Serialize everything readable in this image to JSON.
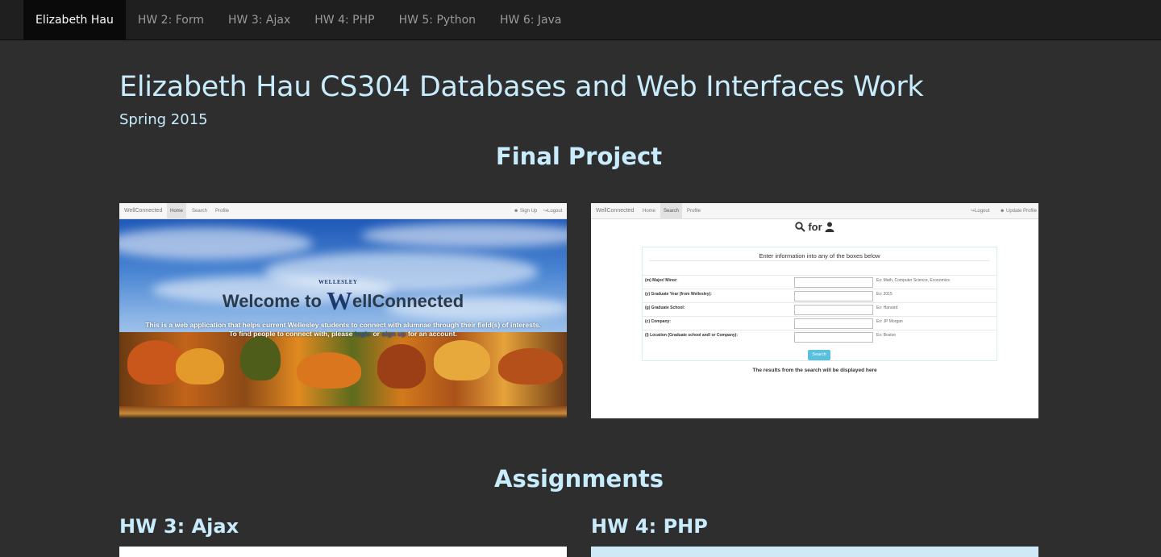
{
  "navbar": {
    "brand": "Elizabeth Hau",
    "items": [
      "HW 2: Form",
      "HW 3: Ajax",
      "HW 4: PHP",
      "HW 5: Python",
      "HW 6: Java"
    ]
  },
  "header": {
    "title": "Elizabeth Hau CS304 Databases and Web Interfaces Work",
    "subtitle": "Spring 2015"
  },
  "final_project": {
    "heading": "Final Project",
    "shot1": {
      "nav_brand": "WellConnected",
      "nav_items": [
        "Home",
        "Search",
        "Profile"
      ],
      "nav_right": [
        "Sign Up",
        "Logout"
      ],
      "welcome_prefix": "Welcome to",
      "logo_w": "W",
      "logo_small": "WELLESLEY",
      "welcome_suffix": "ellConnected",
      "blurb_line1": "This is a web application that helps current Wellesley students to connect with alumnae through their field(s) of interests.",
      "blurb_line2_a": "To find people to connect with, please",
      "blurb_login": "login",
      "blurb_or": "or",
      "blurb_signup": "sign up",
      "blurb_line2_b": "for an account."
    },
    "shot2": {
      "nav_brand": "WellConnected",
      "nav_items": [
        "Home",
        "Search",
        "Profile"
      ],
      "nav_right": [
        "Logout",
        "Update Profile"
      ],
      "search_word": "for",
      "intro": "Enter information into any of the boxes below",
      "rows": [
        {
          "label": "(m) Major/ Minor:",
          "hint": "Ex: Math, Computer Science, Economics"
        },
        {
          "label": "(y) Graduate Year (from Wellesley):",
          "hint": "Ex: 2015"
        },
        {
          "label": "(g) Graduate School:",
          "hint": "Ex: Harvard"
        },
        {
          "label": "(c) Company:",
          "hint": "Ex: JP Morgan"
        },
        {
          "label": "(l) Location (Graduate school and/ or Company):",
          "hint": "Ex: Boston"
        }
      ],
      "button": "Search",
      "results_note": "The results from the search will be displayed here"
    }
  },
  "assignments": {
    "heading": "Assignments",
    "left_title": "HW 3: Ajax",
    "right_title": "HW 4: PHP"
  },
  "colors": {
    "background": "#2e2e2e",
    "navbar": "#1f1f1f",
    "heading": "#c8ecfb"
  }
}
